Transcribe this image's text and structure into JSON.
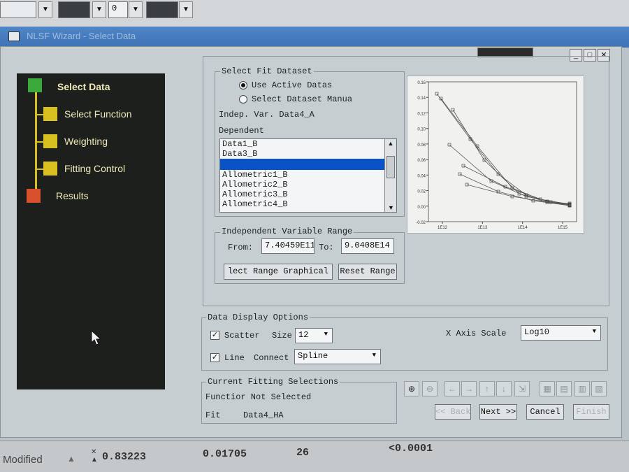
{
  "toolbar": {
    "spin_value": "0"
  },
  "window": {
    "title": "NLSF Wizard - Select Data"
  },
  "wizard": {
    "steps": [
      {
        "label": "Select Data",
        "color": "#3aa83a"
      },
      {
        "label": "Select Function",
        "color": "#d8c020"
      },
      {
        "label": "Weighting",
        "color": "#d8c020"
      },
      {
        "label": "Fitting Control",
        "color": "#d8c020"
      },
      {
        "label": "Results",
        "color": "#d8502c"
      }
    ]
  },
  "select_dataset": {
    "title": "Select Fit Dataset",
    "radio_active": "Use Active Datas",
    "radio_manual": "Select Dataset Manua",
    "indep_var": "Indep. Var. Data4_A",
    "dependent_label": "Dependent",
    "dependent_items": [
      "Data1_B",
      "Data3_B",
      "",
      "Allometric1_B",
      "Allometric2_B",
      "Allometric3_B",
      "Allometric4_B"
    ],
    "selected_index": 2
  },
  "preview_chart": {
    "y_ticks": [
      "0.16",
      "0.14",
      "0.12",
      "0.10",
      "0.08",
      "0.06",
      "0.04",
      "0.02",
      "0.00",
      "-0.02"
    ],
    "x_ticks": [
      "1E12",
      "1E13",
      "1E14",
      "1E15"
    ]
  },
  "range": {
    "title": "Independent Variable Range",
    "from_label": "From:",
    "from_value": "7.40459E11",
    "to_label": "To:",
    "to_value": "9.0408E14",
    "select_graphical": "lect Range Graphical",
    "reset": "Reset Range"
  },
  "display": {
    "title": "Data Display Options",
    "scatter_label": "Scatter",
    "size_label": "Size",
    "size_value": "12",
    "line_label": "Line",
    "connect_label": "Connect",
    "connect_value": "Spline",
    "xaxis_label": "X Axis Scale",
    "xaxis_value": "Log10"
  },
  "current": {
    "title": "Current Fitting Selections",
    "function_text": "Functior Not Selected",
    "fit_label": "Fit",
    "fit_value": "Data4_HA"
  },
  "nav": {
    "back": "<< Back",
    "next": "Next >>",
    "cancel": "Cancel",
    "finish": "Finish"
  },
  "statusbar": {
    "mode": "Modified",
    "v1": "0.83223",
    "v2": "0.01705",
    "v3": "26",
    "v4": "<0.0001"
  },
  "colors": {
    "accent": "#0a52c8",
    "titlebar": "#4579bb",
    "panel": "#c6ced2"
  }
}
